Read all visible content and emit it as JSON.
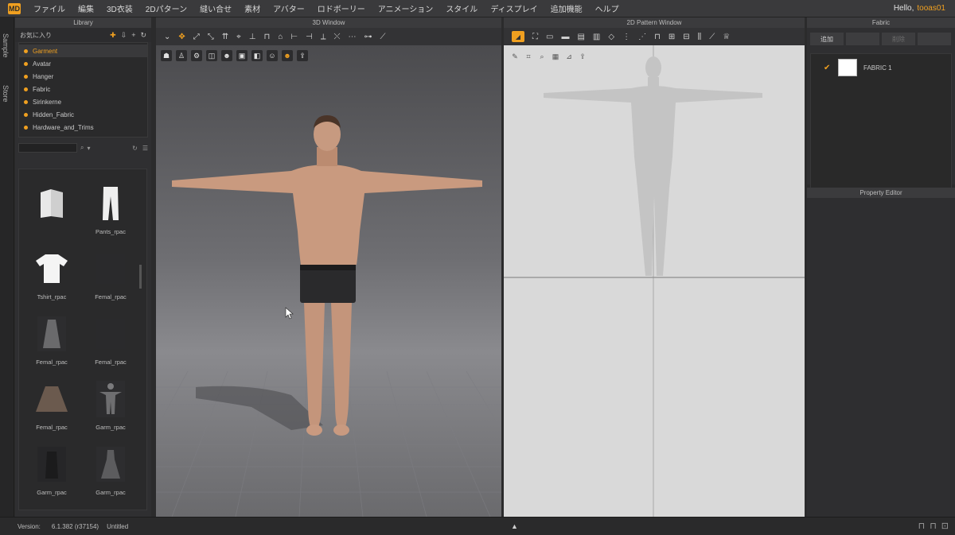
{
  "app": {
    "logo_text": "MD"
  },
  "menu": [
    "ファイル",
    "編集",
    "3D衣装",
    "2Dパターン",
    "縫い合せ",
    "素材",
    "アバター",
    "ロドボーリー",
    "アニメーション",
    "スタイル",
    "ディスプレイ",
    "追加機能",
    "ヘルプ"
  ],
  "greeting": {
    "text": "Hello,",
    "user": "tooas01"
  },
  "side_tabs": [
    "Sample",
    "Store"
  ],
  "library": {
    "title": "Library",
    "header": "お気に入り",
    "folders": [
      {
        "label": "Garment",
        "selected": true
      },
      {
        "label": "Avatar",
        "selected": false
      },
      {
        "label": "Hanger",
        "selected": false
      },
      {
        "label": "Fabric",
        "selected": false
      },
      {
        "label": "Sirinkerne",
        "selected": false
      },
      {
        "label": "Hidden_Fabric",
        "selected": false
      },
      {
        "label": "Hardware_and_Trims",
        "selected": false
      }
    ],
    "items": [
      {
        "label": "",
        "kind": "folder"
      },
      {
        "label": "Pants_rpac",
        "kind": "pants"
      },
      {
        "label": "Tshirt_rpac",
        "kind": "tshirt"
      },
      {
        "label": "Femal_rpac",
        "kind": "dark"
      },
      {
        "label": "Femal_rpac",
        "kind": "dress"
      },
      {
        "label": "Femal_rpac",
        "kind": "dark"
      },
      {
        "label": "Femal_rpac",
        "kind": "skirt"
      },
      {
        "label": "Garm_rpac",
        "kind": "figure"
      },
      {
        "label": "Garm_rpac",
        "kind": "coat"
      },
      {
        "label": "Garm_rpac",
        "kind": "gown"
      }
    ]
  },
  "window_3d": {
    "title": "3D Window"
  },
  "window_2d": {
    "title": "2D Pattern Window"
  },
  "fabric": {
    "title": "Fabric",
    "buttons": [
      {
        "label": "追加",
        "enabled": true
      },
      {
        "label": "",
        "enabled": false
      },
      {
        "label": "削除",
        "enabled": false
      },
      {
        "label": "",
        "enabled": false
      }
    ],
    "item_name": "FABRIC 1",
    "item_color": "#ffffff"
  },
  "property_editor": {
    "title": "Property Editor"
  },
  "status": {
    "label": "Version:",
    "version": "6.1.382 (r37154)",
    "file": "Untitled"
  },
  "colors": {
    "accent": "#f0a020",
    "background": "#2b2b2c",
    "pattern_bg": "#d9d9d9"
  }
}
